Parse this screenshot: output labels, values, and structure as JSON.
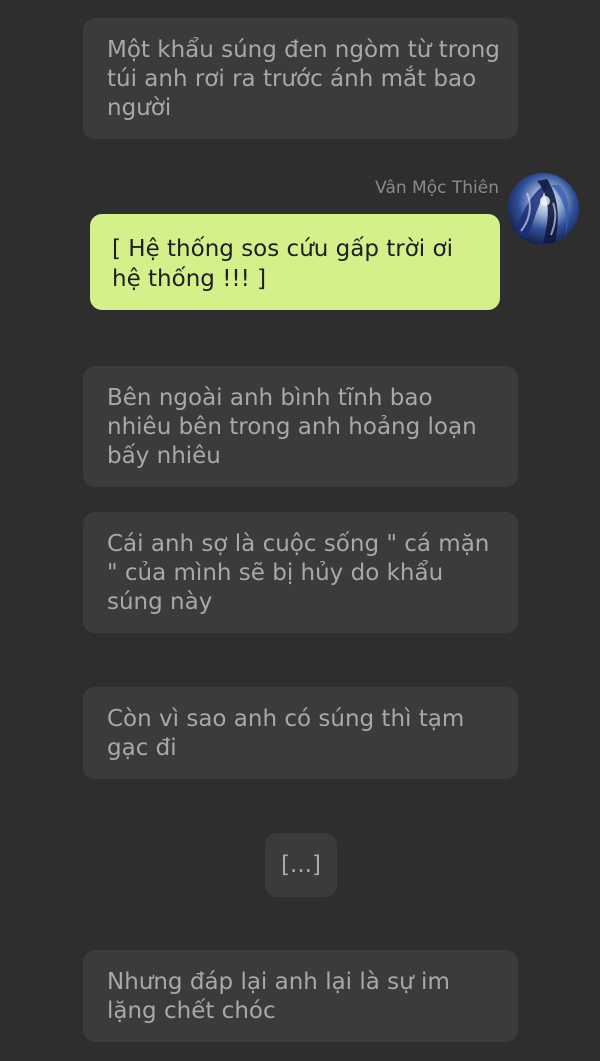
{
  "messages": [
    {
      "text": "Một khẩu súng đen ngòm từ trong túi anh rơi ra trước ánh mắt bao người"
    },
    {
      "sender": "Vân Mộc Thiên",
      "text": "[ Hệ thống sos cứu gấp trời ơi hệ thống !!! ]"
    },
    {
      "text": "Bên ngoài anh bình tĩnh bao nhiêu bên trong anh hoảng loạn bấy nhiêu"
    },
    {
      "text": "Cái anh sợ là cuộc sống \" cá mặn \" của mình sẽ bị hủy do khẩu súng này"
    },
    {
      "text": "Còn vì sao anh có súng thì tạm gạc đi"
    },
    {
      "text": "[...]"
    },
    {
      "text": "Nhưng đáp lại anh lại là sự im lặng chết chóc"
    }
  ],
  "colors": {
    "background": "#2e2e2e",
    "narration_bubble": "#3b3b3b",
    "speech_bubble": "#d4f08a"
  }
}
